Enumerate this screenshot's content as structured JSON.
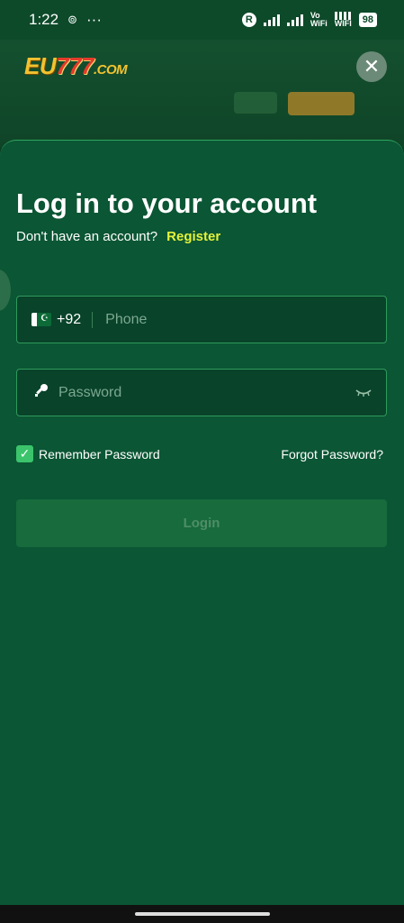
{
  "status_bar": {
    "time": "1:22",
    "dots": "···",
    "r_badge": "R",
    "vo_wifi": "Vo\nWiFi",
    "wifi": "WIFI",
    "battery": "98"
  },
  "header": {
    "logo_eu": "EU",
    "logo_num": "777",
    "logo_com": ".COM",
    "close_symbol": "✕"
  },
  "login": {
    "title": "Log in to your account",
    "no_account_text": "Don't have an account?",
    "register_label": "Register",
    "country_code": "+92",
    "phone_placeholder": "Phone",
    "password_placeholder": "Password",
    "remember_label": "Remember Password",
    "forgot_label": "Forgot Password?",
    "login_label": "Login"
  },
  "icons": {
    "close": "close-icon",
    "flag": "pakistan-flag-icon",
    "key": "key-icon",
    "eye": "eye-closed-icon",
    "check": "checkmark-icon"
  },
  "colors": {
    "background": "#0b5634",
    "accent": "#e5f23a",
    "border": "#2f9a5c",
    "checkbox": "#3bc46b"
  }
}
